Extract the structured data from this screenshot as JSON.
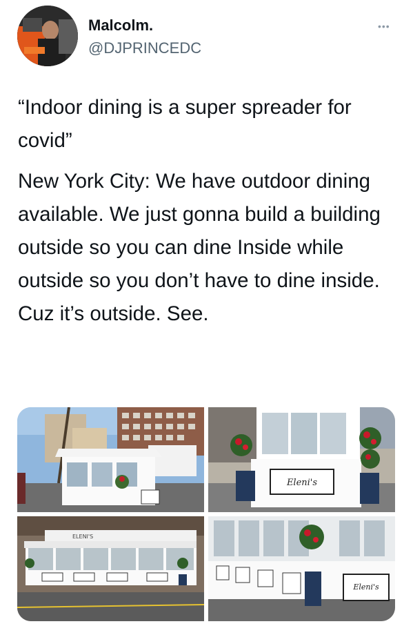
{
  "author": {
    "display_name": "Malcolm.",
    "handle": "@DJPRINCEDC"
  },
  "more_icon": "more-dots-icon",
  "tweet": {
    "paragraphs": [
      "“Indoor dining is a super spreader for covid”",
      "New York City: We have outdoor dining available. We just gonna build a building outside so you can dine Inside while outside so you don’t have to dine inside. Cuz it’s outside. See."
    ]
  },
  "photos": {
    "sign_text_1": "Eleni's",
    "sign_text_2": "Eleni's",
    "awning_text": "ELENI'S"
  },
  "colors": {
    "text": "#0f1419",
    "secondary": "#536471"
  }
}
